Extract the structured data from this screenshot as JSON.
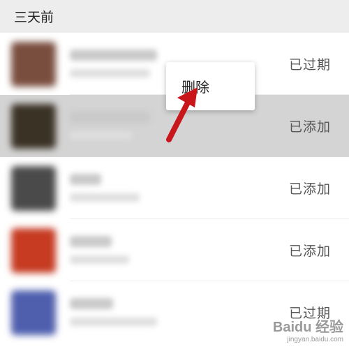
{
  "section": {
    "title": "三天前"
  },
  "rows": [
    {
      "status": "已过期",
      "avatar_color": "#7a4e3e"
    },
    {
      "status": "已添加",
      "avatar_color": "#3b3226",
      "selected": true
    },
    {
      "status": "已添加",
      "avatar_color": "#4a4a4a"
    },
    {
      "status": "已添加",
      "avatar_color": "#c63b22"
    },
    {
      "status": "已过期",
      "avatar_color": "#4f5fae"
    }
  ],
  "context_menu": {
    "delete_label": "删除"
  },
  "annotation": {
    "arrow_color": "#c8161b"
  },
  "watermark": {
    "main": "Baidu 经验",
    "sub": "jingyan.baidu.com"
  }
}
